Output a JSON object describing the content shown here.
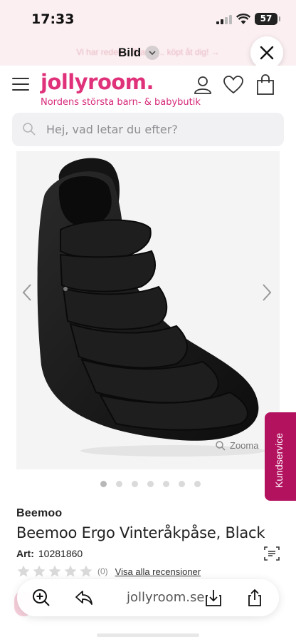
{
  "status_bar": {
    "time": "17:33",
    "battery": "57"
  },
  "browser": {
    "title": "Bild",
    "promo_text": "Vi har reden... Starta ... köpt åt dig! →",
    "url": "jollyroom.se"
  },
  "site": {
    "logo": "jollyroom.",
    "tagline": "Nordens största barn- & babybutik"
  },
  "search": {
    "placeholder": "Hej, vad letar du efter?"
  },
  "gallery": {
    "zoom_label": "Zooma",
    "slide_count": 7,
    "active_slide": 0
  },
  "kundservice_label": "Kundservice",
  "product": {
    "brand": "Beemoo",
    "title": "Beemoo Ergo Vinteråkpåse, Black",
    "art_label": "Art:",
    "art_number": "10281860",
    "rating_count": "(0)",
    "reviews_link": "Visa alla recensioner"
  },
  "colors": {
    "brand_pink": "#e0327a",
    "kundservice_bg": "#b3125f"
  }
}
